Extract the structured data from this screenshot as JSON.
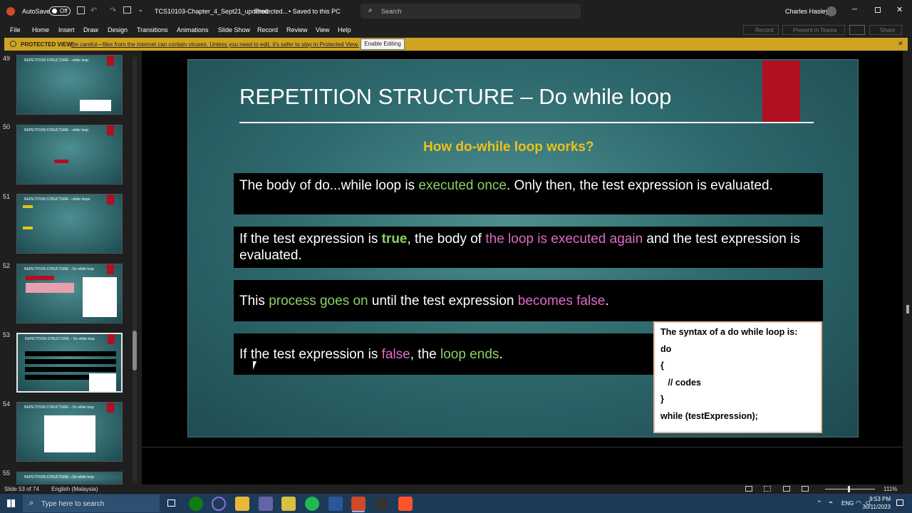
{
  "titlebar": {
    "autosave": "AutoSave",
    "autosave_state": "Off",
    "filename": "TCS10103-Chapter_4_Sept21_updated",
    "protected": "Protected...",
    "saved": "• Saved to this PC",
    "search_placeholder": "Search",
    "user": "Charles Hasley"
  },
  "menu": [
    "File",
    "Home",
    "Insert",
    "Draw",
    "Design",
    "Transitions",
    "Animations",
    "Slide Show",
    "Record",
    "Review",
    "View",
    "Help"
  ],
  "ribbon_right": {
    "record": "Record",
    "present": "Present in Teams",
    "share": "Share"
  },
  "protected_view": {
    "label": "PROTECTED VIEW",
    "message": "Be careful—files from the Internet can contain viruses. Unless you need to edit, it's safer to stay in Protected View.",
    "button": "Enable Editing"
  },
  "thumbnails": [
    {
      "num": "49",
      "title": "REPETITION STRUCTURE – while loop"
    },
    {
      "num": "50",
      "title": "REPETITION STRUCTURE – while loop"
    },
    {
      "num": "51",
      "title": "REPETITION STRUCTURE – while loops"
    },
    {
      "num": "52",
      "title": "REPETITION STRUCTURE – Do while loop"
    },
    {
      "num": "53",
      "title": "REPETITION STRUCTURE – Do while loop"
    },
    {
      "num": "54",
      "title": "REPETITION STRUCTURE – Do while loop"
    },
    {
      "num": "55",
      "title": "REPETITION STRUCTURE – Do while loop"
    }
  ],
  "slide": {
    "title": "REPETITION STRUCTURE – Do while loop",
    "subtitle": "How do-while loop works?",
    "box1": {
      "a": "The body of do...while loop is ",
      "b": "executed once",
      "c": ". Only then, the test expression is evaluated."
    },
    "box2": {
      "a": "If the test expression is ",
      "b": "true",
      "c": ", the body of ",
      "d": "the loop is executed again",
      "e": " and the test expression is evaluated."
    },
    "box3": {
      "a": "This ",
      "b": "process goes on",
      "c": " until the test expression ",
      "d": "becomes false",
      "e": "."
    },
    "box4": {
      "a": "If the test expression is ",
      "b": "false",
      "c": ", the ",
      "d": "loop ends",
      "e": "."
    },
    "syntax": {
      "heading": "The syntax of a  do while loop is:",
      "l1": "do",
      "l2": "{",
      "l3": "   // codes",
      "l4": "}",
      "l5": "while (testExpression);"
    }
  },
  "status": {
    "slide": "Slide 53 of 74",
    "language": "English (Malaysia)",
    "zoom": "111%"
  },
  "taskbar": {
    "search_placeholder": "Type here to search",
    "lang": "ENG",
    "time": "9:53 PM",
    "date": "30/11/2023"
  },
  "colors": {
    "accent_green": "#8cd062",
    "accent_pink": "#e06ac8",
    "subtitle_yellow": "#e8c21a",
    "title_red": "#b01020"
  }
}
